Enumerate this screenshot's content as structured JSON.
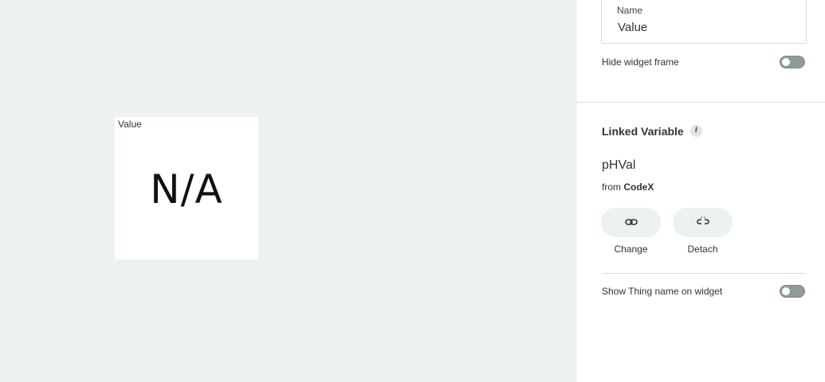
{
  "widget": {
    "title": "Value",
    "value": "N/A"
  },
  "panel": {
    "name_field": {
      "label": "Name",
      "value": "Value"
    },
    "hide_frame": {
      "label": "Hide widget frame",
      "enabled": false
    },
    "linked_variable": {
      "title": "Linked Variable",
      "info_icon": "info-icon",
      "variable_name": "pHVal",
      "source_prefix": "from",
      "source_name": "CodeX",
      "change_label": "Change",
      "change_icon": "link-icon",
      "detach_label": "Detach",
      "detach_icon": "unlink-icon"
    },
    "show_thing_name": {
      "label": "Show Thing name on widget",
      "enabled": false
    }
  },
  "colors": {
    "canvas_bg": "#ecf1f1",
    "panel_bg": "#ffffff",
    "toggle_off": "#8f9a9a",
    "button_bg": "#ecf1f1"
  }
}
